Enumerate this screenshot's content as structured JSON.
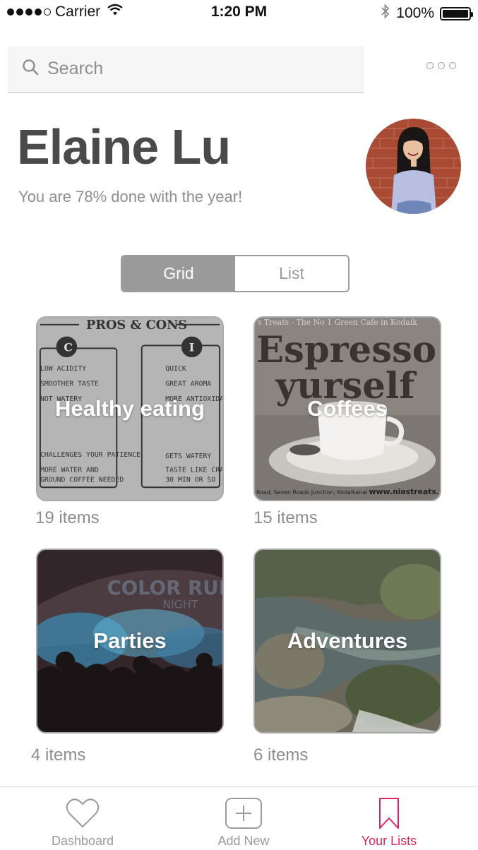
{
  "status_bar": {
    "carrier": "Carrier",
    "time": "1:20 PM",
    "battery": "100%"
  },
  "search": {
    "placeholder": "Search",
    "value": ""
  },
  "profile": {
    "name": "Elaine Lu",
    "subtitle": "You are 78% done with the year!"
  },
  "view_toggle": {
    "grid_label": "Grid",
    "list_label": "List",
    "selected": "Grid"
  },
  "lists": [
    {
      "title": "Healthy eating",
      "count": "19 items"
    },
    {
      "title": "Coffees",
      "count": "15 items"
    },
    {
      "title": "Parties",
      "count": "4 items"
    },
    {
      "title": "Adventures",
      "count": "6 items"
    }
  ],
  "tab_bar": {
    "items": [
      {
        "label": "Dashboard",
        "icon": "heart-icon"
      },
      {
        "label": "Add New",
        "icon": "plus-square-icon"
      },
      {
        "label": "Your Lists",
        "icon": "bookmark-icon"
      }
    ],
    "active": "Your Lists"
  },
  "colors": {
    "accent": "#e0245e",
    "text_dark": "#4a4a4a",
    "text_muted": "#8e8e8e",
    "segment_active": "#9a9a9a"
  }
}
